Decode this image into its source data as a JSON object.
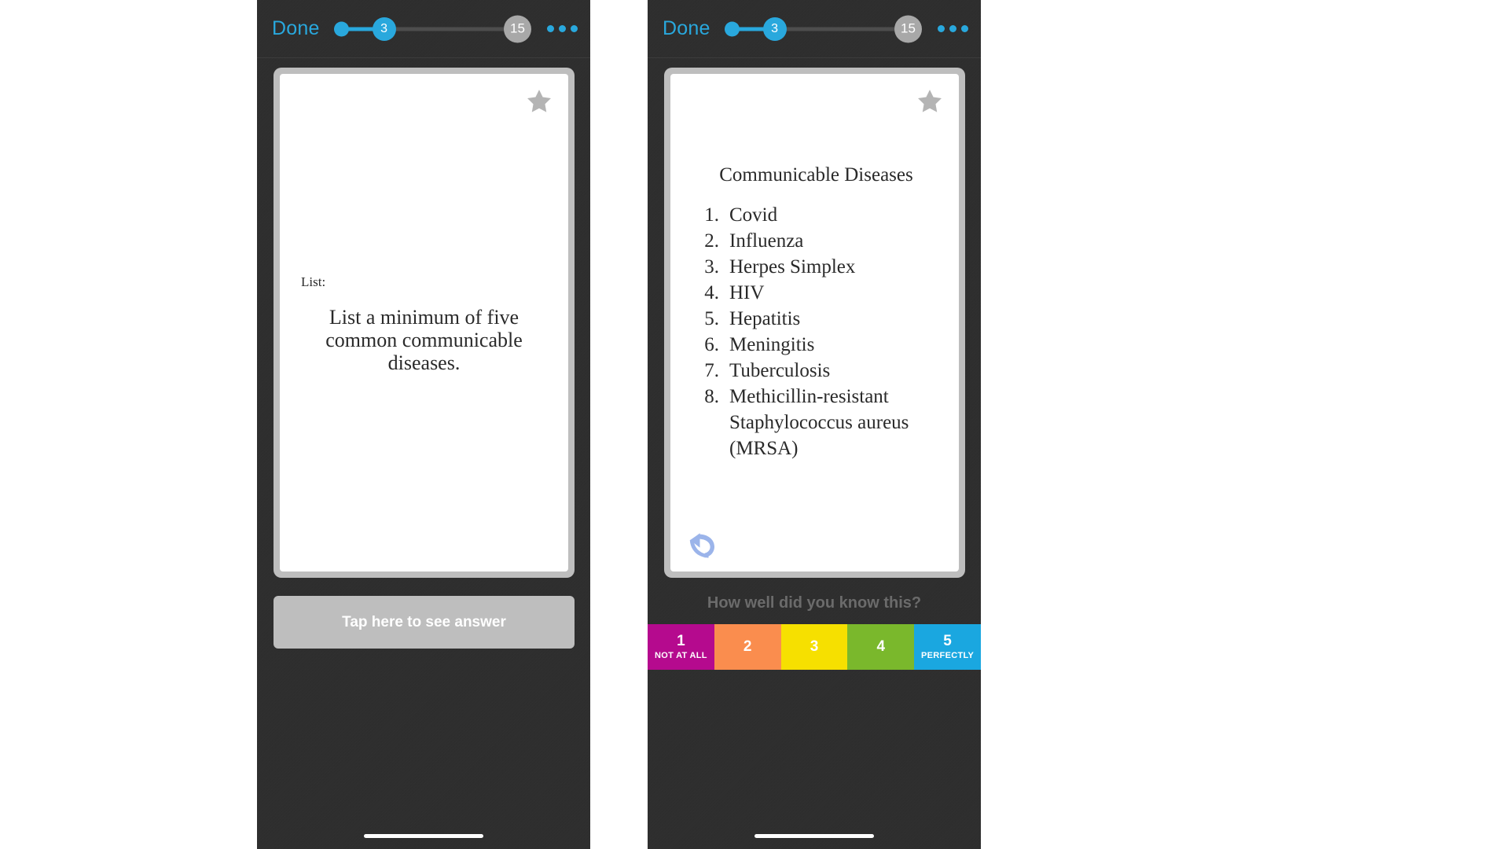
{
  "nav": {
    "done_label": "Done",
    "progress_current": "3",
    "progress_total": "15",
    "more_icon": "ellipsis-icon"
  },
  "left_screen": {
    "star_icon": "star-icon",
    "question_label": "List:",
    "question_text": "List a minimum of five common communicable diseases.",
    "reveal_button": "Tap here to see answer"
  },
  "right_screen": {
    "star_icon": "star-icon",
    "undo_icon": "undo-arrow-icon",
    "answer_title": "Communicable Diseases",
    "answer_items": [
      {
        "num": "1.",
        "text": "Covid"
      },
      {
        "num": "2.",
        "text": "Influenza"
      },
      {
        "num": "3.",
        "text": "Herpes Simplex"
      },
      {
        "num": "4.",
        "text": "HIV"
      },
      {
        "num": "5.",
        "text": "Hepatitis"
      },
      {
        "num": "6.",
        "text": "Meningitis"
      },
      {
        "num": "7.",
        "text": "Tuberculosis"
      },
      {
        "num": "8.",
        "text": "Methicillin-resistant Staphylococcus aureus (MRSA)"
      }
    ],
    "rating_prompt": "How well did you know this?",
    "ratings": [
      {
        "num": "1",
        "sub": "NOT AT ALL",
        "color": "#b50a8e"
      },
      {
        "num": "2",
        "sub": "",
        "color": "#fa8d4e"
      },
      {
        "num": "3",
        "sub": "",
        "color": "#f6e000"
      },
      {
        "num": "4",
        "sub": "",
        "color": "#7ab82c"
      },
      {
        "num": "5",
        "sub": "PERFECTLY",
        "color": "#1aa7e0"
      }
    ]
  },
  "colors": {
    "accent_blue": "#29a8dd",
    "card_border": "#bebebe",
    "shell": "#2e2e2e",
    "undo_blue": "#9bb4ea"
  }
}
